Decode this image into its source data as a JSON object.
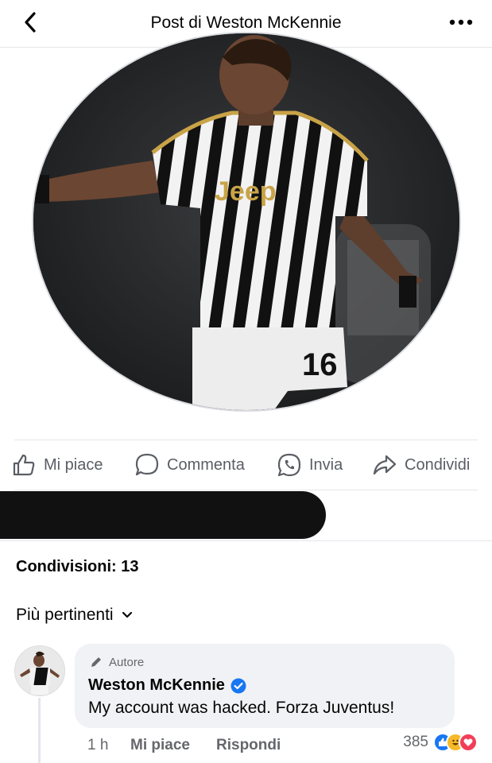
{
  "header": {
    "title": "Post di Weston McKennie",
    "back_icon": "chevron-left-icon",
    "more_icon": "more-horizontal-icon"
  },
  "post": {
    "image_alt": "Weston McKennie in Juventus jersey number 16",
    "jersey_number": "16",
    "sponsor": "Jeep",
    "accent_color": "#1877f2"
  },
  "actions": {
    "like": "Mi piace",
    "comment": "Commenta",
    "send": "Invia",
    "share": "Condividi"
  },
  "shares_text": "Condivisioni: 13",
  "filter_label": "Più pertinenti",
  "comment": {
    "author_badge": "Autore",
    "name": "Weston McKennie",
    "verified": true,
    "text": "My account was hacked. Forza Juventus!",
    "time": "1 h",
    "like_label": "Mi piace",
    "reply_label": "Rispondi",
    "reaction_count": "385",
    "reactions": [
      "like",
      "haha",
      "love"
    ]
  }
}
